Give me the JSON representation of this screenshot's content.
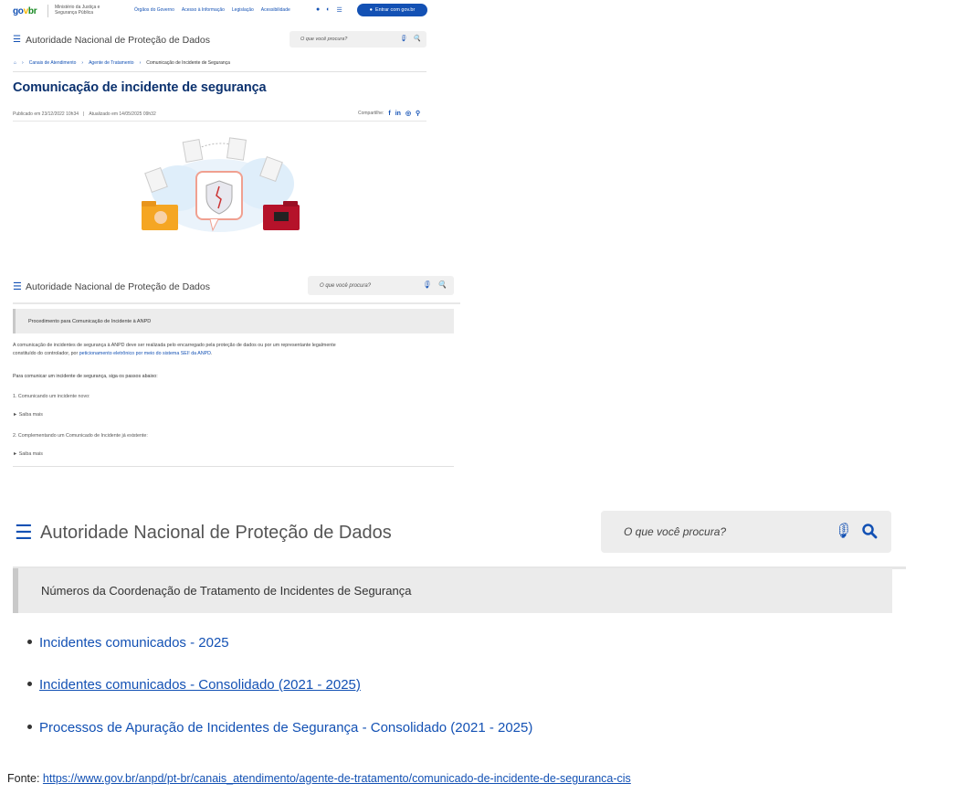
{
  "header": {
    "logo": {
      "g": "go",
      "v": "v",
      "b": "br"
    },
    "ministry": "Ministério da Justiça e Segurança Pública",
    "links": [
      "Órgãos do Governo",
      "Acesso à Informação",
      "Legislação",
      "Acessibilidade"
    ],
    "login_label": "Entrar com gov.br"
  },
  "site_title": "Autoridade Nacional de Proteção de Dados",
  "search_placeholder": "O que você procura?",
  "breadcrumb": [
    "Canais de Atendimento",
    "Agente de Tratamento",
    "Comunicação de Incidente de Segurança"
  ],
  "page_title": "Comunicação de incidente de segurança",
  "published": "Publicado em 23/12/2022 10h34",
  "updated": "Atualizado em 14/05/2025 09h32",
  "share_label": "Compartilhe:",
  "section2": {
    "box_title": "Procedimento para Comunicação de Incidente à ANPD",
    "para_a": "A comunicação de incidentes de segurança à ANPD deve ser realizada pelo encarregado pela proteção de dados ou por um representante legalmente",
    "para_b": "constituído do controlador, por ",
    "para_link": "peticionamento eletrônico por meio do sistema SEI! da ANPD",
    "para_end": ".",
    "steps_intro": "Para comunicar um incidente de segurança, siga os passos abaixo:",
    "step1": "1. Comunicando um incidente novo:",
    "saiba1": "► Saiba mais",
    "step2": "2. Complementando um Comunicado de Incidente já existente:",
    "saiba2": "► Saiba mais"
  },
  "section3": {
    "box_title": "Números da Coordenação de Tratamento de Incidentes de Segurança",
    "items": [
      "Incidentes comunicados - 2025",
      "Incidentes comunicados - Consolidado (2021 - 2025)",
      "Processos de Apuração de Incidentes de Segurança - Consolidado (2021 - 2025)"
    ]
  },
  "fonte_label": "Fonte: ",
  "fonte_url": "https://www.gov.br/anpd/pt-br/canais_atendimento/agente-de-tratamento/comunicado-de-incidente-de-seguranca-cis",
  "colors": {
    "brand_blue": "#1351b4",
    "title_blue": "#0c326f",
    "folder_orange": "#f5a623",
    "folder_red": "#b5122a"
  }
}
